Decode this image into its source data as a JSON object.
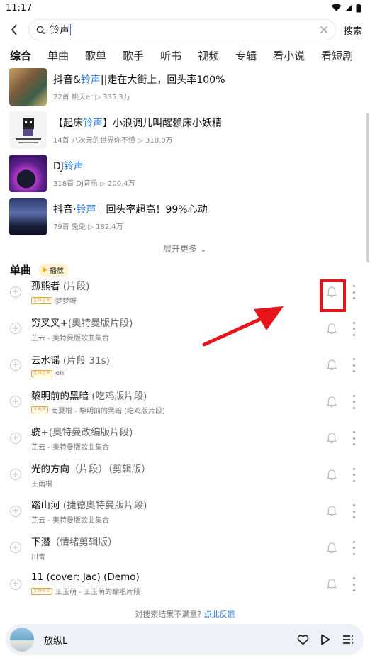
{
  "status_bar": {
    "time": "11:17"
  },
  "search": {
    "query": "铃声",
    "button_label": "搜索"
  },
  "tabs": [
    "综合",
    "单曲",
    "歌单",
    "歌手",
    "听书",
    "视频",
    "专辑",
    "看小说",
    "看短剧"
  ],
  "playlists": [
    {
      "title_pre": "抖音&",
      "title_hl": "铃声",
      "title_post": "||走在大街上，回头率100%",
      "count": "22首",
      "author": "桃夭er",
      "plays": "335.3万"
    },
    {
      "title_pre": "【起床",
      "title_hl": "铃声",
      "title_post": "】小浪调儿叫醒赖床小妖精",
      "count": "14首",
      "author": "八次元的世界你不懂",
      "plays": "318.0万"
    },
    {
      "title_pre": "DJ",
      "title_hl": "铃声",
      "title_post": "",
      "count": "318首",
      "author": "DJ音乐",
      "plays": "200.4万"
    },
    {
      "title_pre": "抖音·",
      "title_hl": "铃声",
      "title_post": "｜回头率超高！99%心动",
      "count": "79首",
      "author": "兔兔",
      "plays": "182.4万"
    }
  ],
  "show_more": "展开更多",
  "songs_section": {
    "title": "单曲",
    "play_label": "播放"
  },
  "songs": [
    {
      "title": "孤熊者",
      "version": "(片段)",
      "tag": "至臻音质",
      "artist": "梦梦呀"
    },
    {
      "title": "穷叉叉+",
      "version": "(奥特曼版片段)",
      "tag": "",
      "artist": "芷云 - 奥特曼版歌曲集合"
    },
    {
      "title": "云水谣",
      "version": "(片段 31s)",
      "tag": "至臻音质",
      "artist": "en"
    },
    {
      "title": "黎明前的黑暗",
      "version": "(吃鸡版片段)",
      "tag": "全景声",
      "artist": "南夏桐 - 黎明前的黑暗 (吃鸡版片段)"
    },
    {
      "title": "骁+",
      "version": "(奥特曼改编版片段)",
      "tag": "",
      "artist": "芷云 - 奥特曼版歌曲集合"
    },
    {
      "title": "光的方向",
      "version": "（片段）（剪辑版）",
      "tag": "",
      "artist": "王雨桐"
    },
    {
      "title": "踏山河",
      "version": "(捷德奥特曼版片段)",
      "tag": "",
      "artist": "芷云 - 奥特曼版歌曲集合"
    },
    {
      "title": "下潜",
      "version": "（情绪剪辑版）",
      "tag": "",
      "artist": "川青"
    },
    {
      "title": "11 (cover: Jac)",
      "version": "(Demo)",
      "tag": "至臻母带",
      "artist": "王玉萌 - 王玉萌的翻唱片段"
    }
  ],
  "feedback": {
    "text": "对搜索结果不满意?",
    "link": "点此反馈"
  },
  "player": {
    "title": "放纵L"
  },
  "colors": {
    "accent": "#2a7de1",
    "tab_underline": "#f6d64c",
    "annotation": "#e8141b"
  }
}
